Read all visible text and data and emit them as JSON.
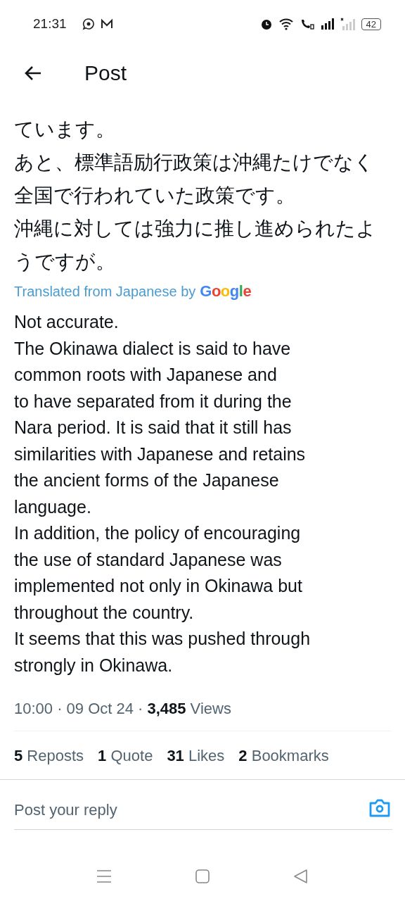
{
  "status_bar": {
    "time": "21:31",
    "battery": "42"
  },
  "header": {
    "title": "Post"
  },
  "original_text": {
    "lines": [
      "ています。",
      "あと、標準語励行政策は沖縄たけでなく",
      "全国で行われていた政策です。",
      "沖縄に対しては強力に推し進められたよ",
      "うですが。"
    ]
  },
  "translation": {
    "label": "Translated from Japanese by",
    "provider": "Google"
  },
  "translated_lines": [
    "Not accurate.",
    "The Okinawa dialect is said to have",
    "common roots with Japanese and",
    "to have separated from it during the",
    "Nara period. It is said that it still has",
    "similarities with Japanese and retains",
    "the ancient forms of the Japanese",
    "language.",
    "In addition, the policy of encouraging",
    "the use of standard Japanese was",
    "implemented not only in Okinawa but",
    "throughout the country.",
    "It seems that this was pushed through",
    "strongly in Okinawa."
  ],
  "meta": {
    "time": "10:00",
    "separator": "·",
    "date": "09 Oct 24",
    "views_count": "3,485",
    "views_label": "Views"
  },
  "stats": [
    {
      "count": "5",
      "label": "Reposts"
    },
    {
      "count": "1",
      "label": "Quote"
    },
    {
      "count": "31",
      "label": "Likes"
    },
    {
      "count": "2",
      "label": "Bookmarks"
    }
  ],
  "reply": {
    "placeholder": "Post your reply"
  }
}
